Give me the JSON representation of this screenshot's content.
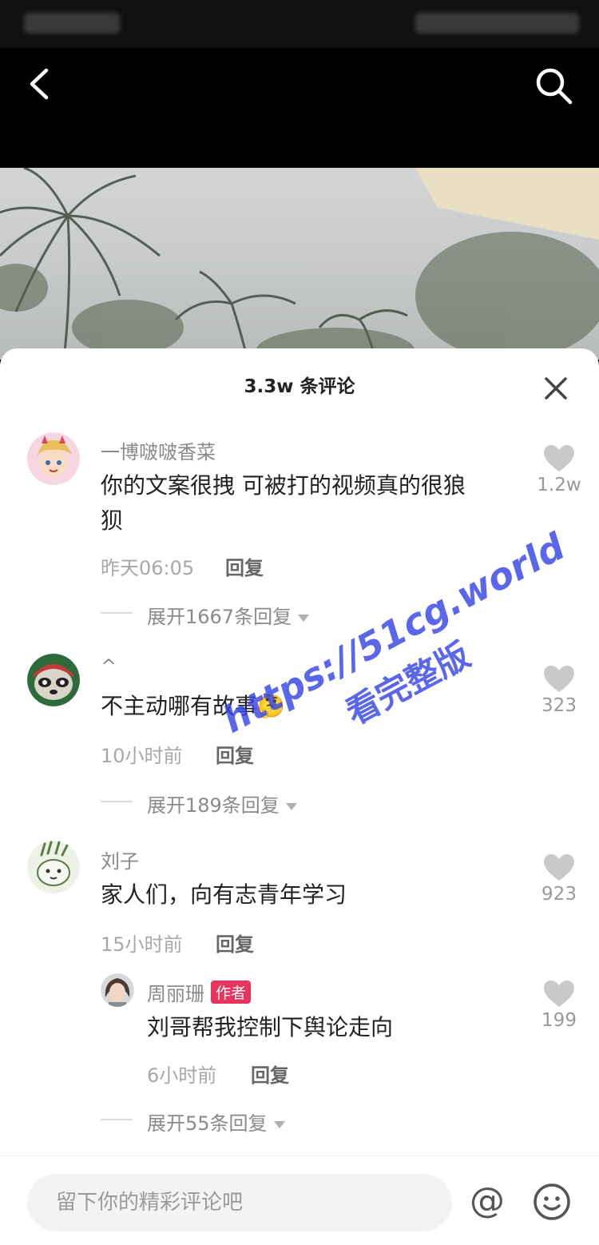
{
  "sheet": {
    "title": "3.3w 条评论"
  },
  "comments": [
    {
      "name": "一博啵啵香菜",
      "text_line1": "你的文案很拽 可被打的视频真的很狼",
      "text_line2": "狈",
      "time": "昨天06:05",
      "reply_label": "回复",
      "likes": "1.2w",
      "expand": "展开1667条回复"
    },
    {
      "name": "^",
      "text": "不主动哪有故事",
      "emoji": "🤔",
      "time": "10小时前",
      "reply_label": "回复",
      "likes": "323",
      "expand": "展开189条回复"
    },
    {
      "name": "刘子",
      "text": "家人们，向有志青年学习",
      "time": "15小时前",
      "reply_label": "回复",
      "likes": "923",
      "sub_reply": {
        "name": "周丽珊",
        "badge": "作者",
        "text": "刘哥帮我控制下舆论走向",
        "time": "6小时前",
        "reply_label": "回复",
        "likes": "199"
      },
      "expand": "展开55条回复"
    }
  ],
  "input": {
    "placeholder": "留下你的精彩评论吧",
    "at_symbol": "@"
  },
  "watermark": {
    "url": "https://51cg.world",
    "subtitle": "看完整版"
  },
  "colors": {
    "author_badge": "#e8335c",
    "watermark": "#3646e6"
  }
}
